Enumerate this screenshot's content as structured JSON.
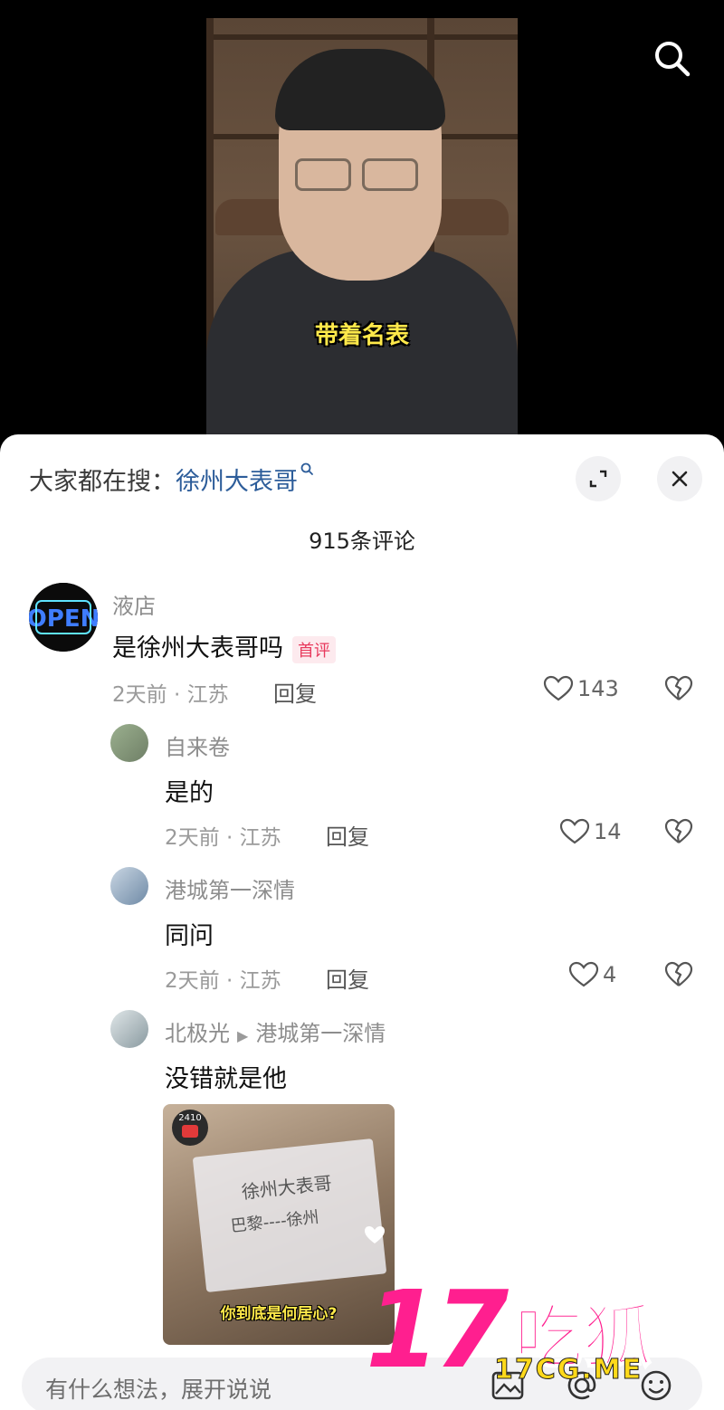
{
  "video": {
    "caption": "带着名表"
  },
  "sheet": {
    "hot_search_prefix": "大家都在搜：",
    "hot_search_term": "徐州大表哥",
    "comment_count_title": "915条评论"
  },
  "comments": [
    {
      "user": "液店",
      "text": "是徐州大表哥吗",
      "badge": "首评",
      "meta": "2天前 · 江苏",
      "reply_label": "回复",
      "likes": "143"
    },
    {
      "user": "自来卷",
      "text": "是的",
      "meta": "2天前 · 江苏",
      "reply_label": "回复",
      "likes": "14"
    },
    {
      "user": "港城第一深情",
      "text": "同问",
      "meta": "2天前 · 江苏",
      "reply_label": "回复",
      "likes": "4"
    },
    {
      "user": "北极光",
      "reply_to": "港城第一深情",
      "text": "没错就是他",
      "image": {
        "counter": "2410",
        "paper_line_1": "徐州大表哥",
        "paper_line_2": "巴黎----徐州",
        "caption": "你到底是何居心?"
      }
    }
  ],
  "input": {
    "placeholder": "有什么想法，展开说说"
  },
  "watermark": {
    "number": "17",
    "text": "吃狐",
    "url": "17CG.ME"
  },
  "colors": {
    "link": "#2d5d9a",
    "badge": "#e83a5d",
    "watermark_pink": "#ff1f8f",
    "watermark_yellow": "#ffd91a"
  }
}
